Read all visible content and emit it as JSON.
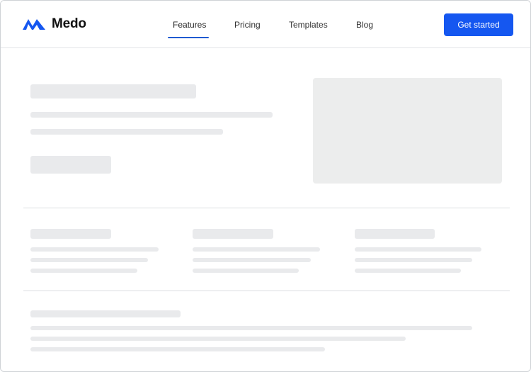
{
  "brand": {
    "name": "Medo",
    "logo_icon": "m-wave-logo-icon",
    "accent": "#1557f0"
  },
  "nav": {
    "items": [
      {
        "label": "Features",
        "active": true
      },
      {
        "label": "Pricing",
        "active": false
      },
      {
        "label": "Templates",
        "active": false
      },
      {
        "label": "Blog",
        "active": false
      }
    ]
  },
  "cta": {
    "label": "Get started"
  }
}
